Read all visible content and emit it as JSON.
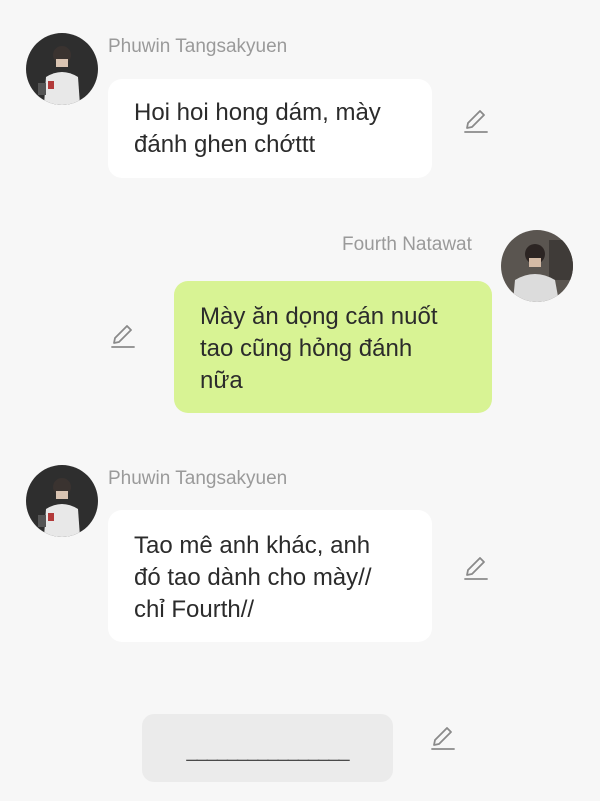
{
  "messages": [
    {
      "sender": "Phuwin Tangsakyuen",
      "direction": "incoming",
      "lines": [
        "Hoi hoi hong dám, mày",
        "đánh ghen chớttt"
      ]
    },
    {
      "sender": "Fourth Natawat",
      "direction": "outgoing",
      "lines": [
        "Mày ăn dọng cán nuốt",
        "tao cũng hỏng đánh",
        "nữa"
      ]
    },
    {
      "sender": "Phuwin Tangsakyuen",
      "direction": "incoming",
      "lines": [
        "Tao mê anh khác, anh",
        "đó tao dành cho mày//",
        "chỉ Fourth//"
      ]
    }
  ],
  "composer": {
    "value": "________________"
  },
  "icons": {
    "edit": "pencil-edit-icon",
    "avatar": "user-avatar-photo"
  },
  "colors": {
    "background": "#f7f7f7",
    "incoming_bubble": "#ffffff",
    "outgoing_bubble": "#d8f394",
    "name_text": "#9a9a9a",
    "message_text": "#2b2b2b",
    "composer_bg": "#ebebeb"
  }
}
